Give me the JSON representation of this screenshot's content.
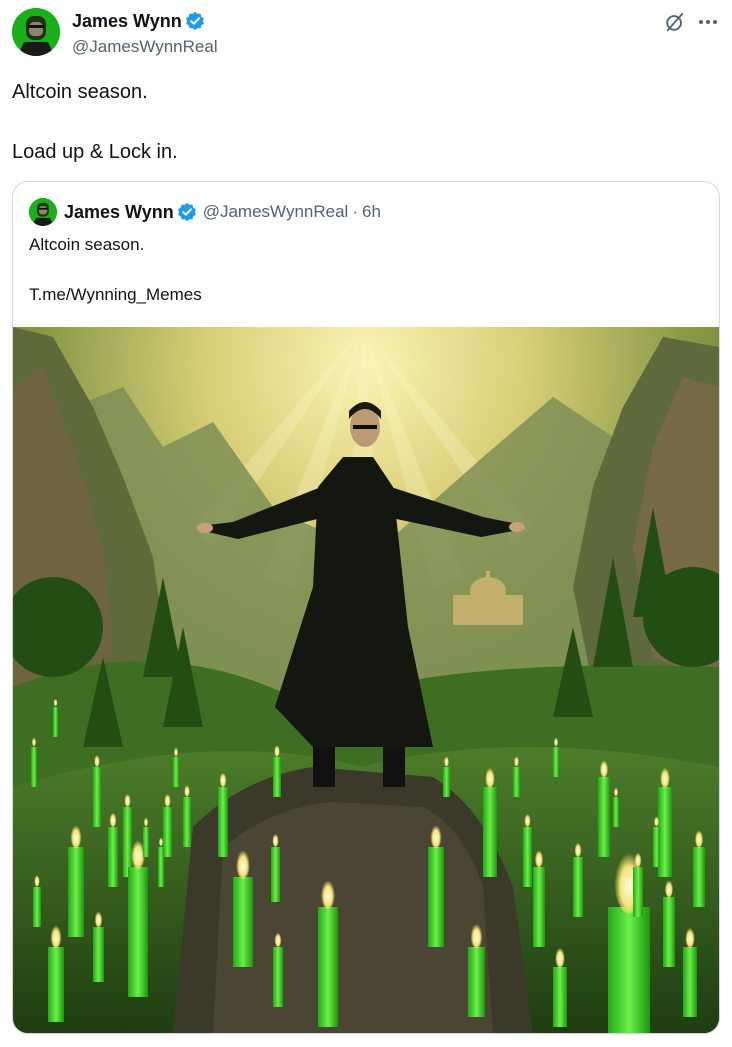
{
  "tweet": {
    "author_name": "James Wynn",
    "author_handle": "@JamesWynnReal",
    "text_line_1": "Altcoin season.",
    "text_line_2": "Load up & Lock in.",
    "icons": {
      "verified": "verified-badge-icon",
      "grok": "grok-icon",
      "more": "more-options-icon"
    }
  },
  "quoted_tweet": {
    "author_name": "James Wynn",
    "author_handle": "@JamesWynnReal",
    "separator": "·",
    "time": "6h",
    "text_line_1": "Altcoin season.",
    "text_line_2": "T.me/Wynning_Memes",
    "media": "matrix-figure-green-candles-image"
  },
  "colors": {
    "verified_blue": "#1d9bf0",
    "secondary_text": "#536471",
    "primary_text": "#0f1419",
    "border": "#cfd9de",
    "candle_green": "#3ddc2a"
  }
}
